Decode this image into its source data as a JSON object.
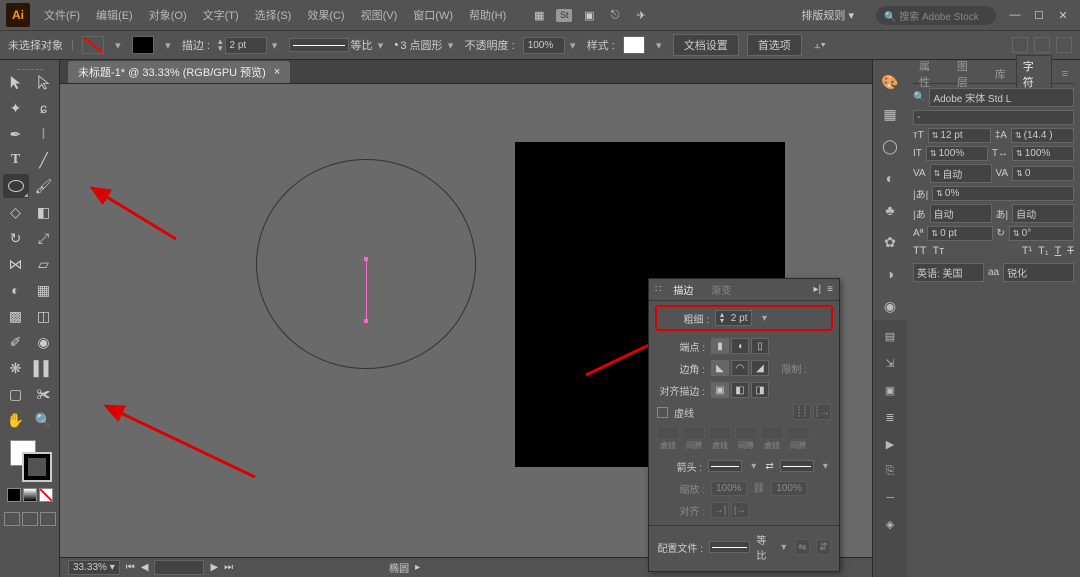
{
  "menu": {
    "file": "文件(F)",
    "edit": "编辑(E)",
    "object": "对象(O)",
    "type": "文字(T)",
    "select": "选择(S)",
    "effect": "效果(C)",
    "view": "视图(V)",
    "window": "窗口(W)",
    "help": "帮助(H)"
  },
  "titlebar": {
    "workspace": "排版规则",
    "search_placeholder": "搜索 Adobe Stock"
  },
  "options": {
    "no_selection": "未选择对象",
    "stroke_label": "描边 :",
    "stroke_weight": "2 pt",
    "scale_label": "等比",
    "dash_profile": "3 点圆形",
    "opacity_label": "不透明度 :",
    "opacity_value": "100%",
    "style_label": "样式 :",
    "doc_setup": "文档设置",
    "preferences": "首选项"
  },
  "document": {
    "tab_title": "未标题-1* @ 33.33% (RGB/GPU 预览)"
  },
  "status": {
    "zoom": "33.33%",
    "tool_name": "椭圆"
  },
  "stroke_panel": {
    "tab_stroke": "描边",
    "tab_gradient": "渐变",
    "weight_label": "粗细 :",
    "weight_value": "2 pt",
    "cap_label": "端点 :",
    "corner_label": "边角 :",
    "limit_label": "限制 :",
    "align_label": "对齐描边 :",
    "dashed_label": "虚线",
    "dash1": "虚线",
    "gap1": "间隙",
    "dash2": "虚线",
    "gap2": "间隙",
    "dash3": "虚线",
    "gap3": "间隙",
    "arrow_label": "箭头 :",
    "scale_label": "缩放 :",
    "scale_v1": "100%",
    "scale_v2": "100%",
    "align_arrows": "对齐 :",
    "profile_label": "配置文件 :",
    "profile_value": "等比"
  },
  "char_panel": {
    "tabs": {
      "props": "属性",
      "layers": "图层",
      "libs": "库",
      "char": "字符"
    },
    "font_family": "Adobe 宋体 Std L",
    "font_style": "-",
    "size": "12 pt",
    "leading": "(14.4 )",
    "hscale": "100%",
    "vscale": "100%",
    "kerning": "自动",
    "tracking": "0",
    "hpos": "0%",
    "auto_label": "自动",
    "baseline": "0 pt",
    "rotation": "0°",
    "lang": "英语: 美国",
    "antialias": "锐化"
  }
}
